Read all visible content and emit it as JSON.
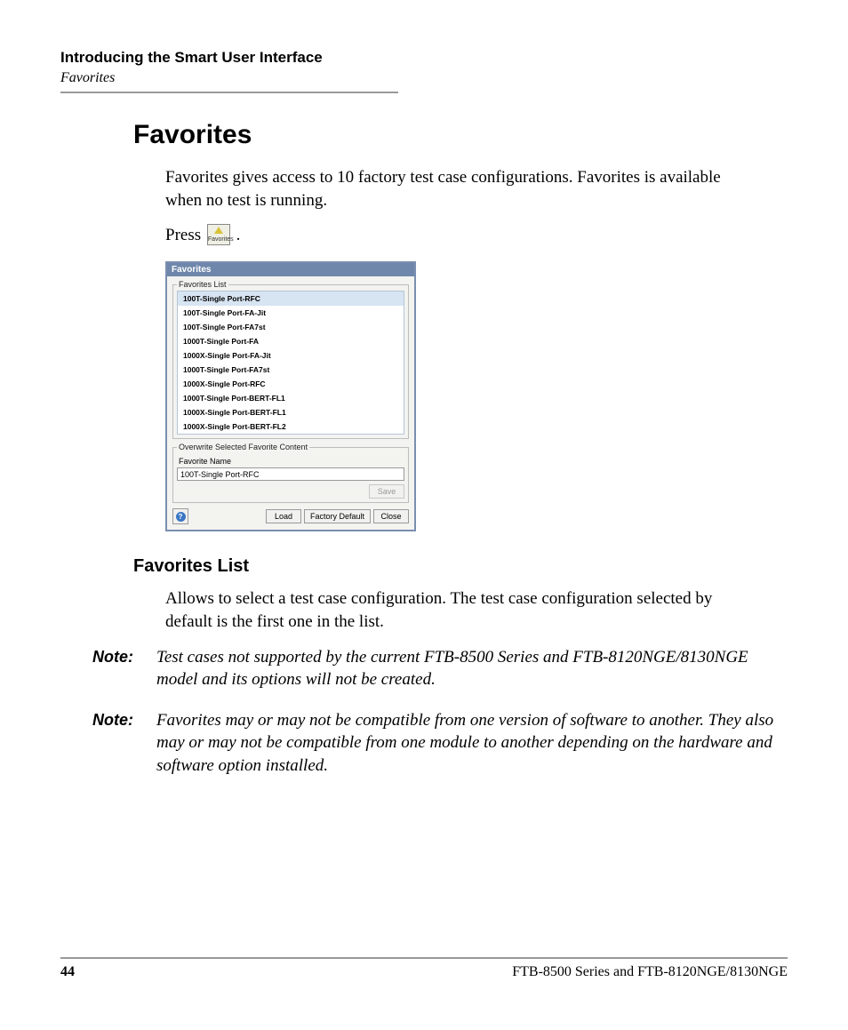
{
  "header": {
    "chapter_title": "Introducing the Smart User Interface",
    "chapter_subtitle": "Favorites"
  },
  "section": {
    "title": "Favorites",
    "intro": "Favorites gives access to 10 factory test case configurations. Favorites is available when no test is running.",
    "press_label": "Press",
    "press_period": ".",
    "icon_caption": "Favorites"
  },
  "dialog": {
    "title": "Favorites",
    "list_legend": "Favorites List",
    "items": [
      "100T-Single Port-RFC",
      "100T-Single Port-FA-Jit",
      "100T-Single Port-FA7st",
      "1000T-Single Port-FA",
      "1000X-Single Port-FA-Jit",
      "1000T-Single Port-FA7st",
      "1000X-Single Port-RFC",
      "1000T-Single Port-BERT-FL1",
      "1000X-Single Port-BERT-FL1",
      "1000X-Single Port-BERT-FL2"
    ],
    "selected_index": 0,
    "overwrite_legend": "Overwrite Selected Favorite Content",
    "favorite_name_label": "Favorite Name",
    "favorite_name_value": "100T-Single Port-RFC",
    "save_button": "Save",
    "load_button": "Load",
    "factory_default_button": "Factory Default",
    "close_button": "Close"
  },
  "subsection": {
    "title": "Favorites List",
    "body": "Allows to select a test case configuration. The test case configuration selected by default is the first one in the list."
  },
  "notes": {
    "label": "Note:",
    "note1": "Test cases not supported by the current FTB-8500 Series and FTB-8120NGE/8130NGE model and its options will not be created.",
    "note2": "Favorites may or may not be compatible from one version of software to another. They also may or may not be compatible from one module to another depending on the hardware and software option installed."
  },
  "footer": {
    "page_number": "44",
    "product_line": "FTB-8500 Series and FTB-8120NGE/8130NGE"
  }
}
